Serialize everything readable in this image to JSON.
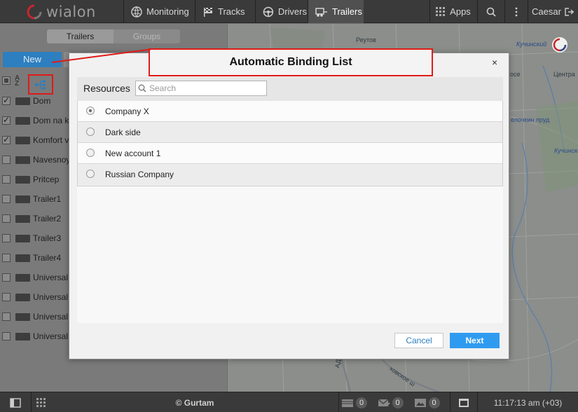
{
  "topbar": {
    "logo_text": "wialon",
    "nav": [
      {
        "label": "Monitoring",
        "icon": "globe-icon"
      },
      {
        "label": "Tracks",
        "icon": "checkered-flag-icon"
      },
      {
        "label": "Drivers",
        "icon": "steering-wheel-icon"
      },
      {
        "label": "Trailers",
        "icon": "trailer-icon",
        "active": true
      }
    ],
    "apps_label": "Apps",
    "user_label": "Caesar"
  },
  "left_panel": {
    "segments": [
      "Trailers",
      "Groups"
    ],
    "new_button": "New",
    "az_label": "A Z",
    "units": [
      {
        "name": "Dom",
        "checked": true
      },
      {
        "name": "Dom na k",
        "checked": true
      },
      {
        "name": "Komfort v",
        "checked": true
      },
      {
        "name": "Navesnoy",
        "checked": false
      },
      {
        "name": "Pritcep",
        "checked": false
      },
      {
        "name": "Trailer1",
        "checked": false
      },
      {
        "name": "Trailer2",
        "checked": false
      },
      {
        "name": "Trailer3",
        "checked": false
      },
      {
        "name": "Trailer4",
        "checked": false
      },
      {
        "name": "Universal",
        "checked": false
      },
      {
        "name": "Universal",
        "checked": false
      },
      {
        "name": "Universal",
        "checked": false
      },
      {
        "name": "Universal",
        "checked": false
      }
    ]
  },
  "map": {
    "labels": [
      "Реутов",
      "Кучинский",
      "Центра",
      "Кучинский",
      "елочкин пруд",
      "осе",
      "АД",
      "ховское ш"
    ]
  },
  "dialog": {
    "title": "Automatic Binding List",
    "close": "×",
    "resources_label": "Resources",
    "search_placeholder": "Search",
    "resources": [
      {
        "name": "Company X",
        "selected": true
      },
      {
        "name": "Dark side",
        "selected": false
      },
      {
        "name": "New account 1",
        "selected": false
      },
      {
        "name": "Russian Company",
        "selected": false
      }
    ],
    "cancel_label": "Cancel",
    "next_label": "Next"
  },
  "bottombar": {
    "copyright": "© Gurtam",
    "counts": [
      "0",
      "0",
      "0"
    ],
    "time": "11:17:13 am (+03)"
  },
  "colors": {
    "accent": "#2f9bf0",
    "highlight": "#e01a1a",
    "topbar": "#3a3a3a"
  }
}
